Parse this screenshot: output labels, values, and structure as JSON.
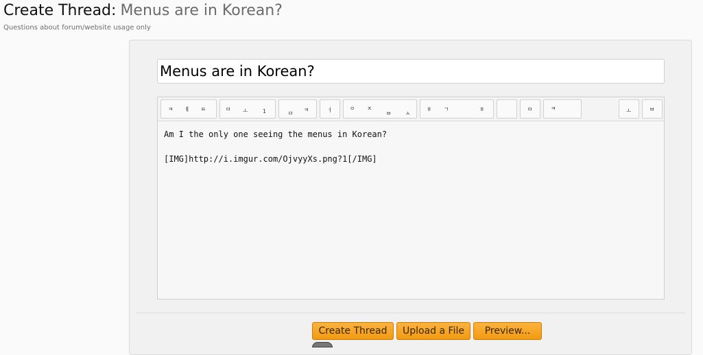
{
  "header": {
    "title_prefix": "Create Thread:",
    "thread_title": "Menus are in Korean?",
    "subtitle": "Questions about forum/website usage only"
  },
  "form": {
    "title_value": "Menus are in Korean?",
    "toolbar_glyphs": [
      "ㅋ",
      "ㅖ",
      "ㅌ",
      "ㅁ",
      "ㅗ",
      "1",
      "ㅁ",
      "ㅋ",
      "ㅓ",
      "ㅇ",
      "ㅈ",
      "ㅂ",
      "ㅅ",
      "ㅎ",
      "ㄱ",
      "ㅎ",
      "ㅁ",
      "ㅋ",
      "ㅗ",
      "ㅂ"
    ],
    "body_text": "Am I the only one seeing the menus in Korean?\n\n[IMG]http://i.imgur.com/OjvyyXs.png?1[/IMG]"
  },
  "buttons": {
    "create": "Create Thread",
    "upload": "Upload a File",
    "preview": "Preview..."
  },
  "colors": {
    "button_accent": "#f5a623",
    "panel_bg": "#f1f1f1"
  }
}
